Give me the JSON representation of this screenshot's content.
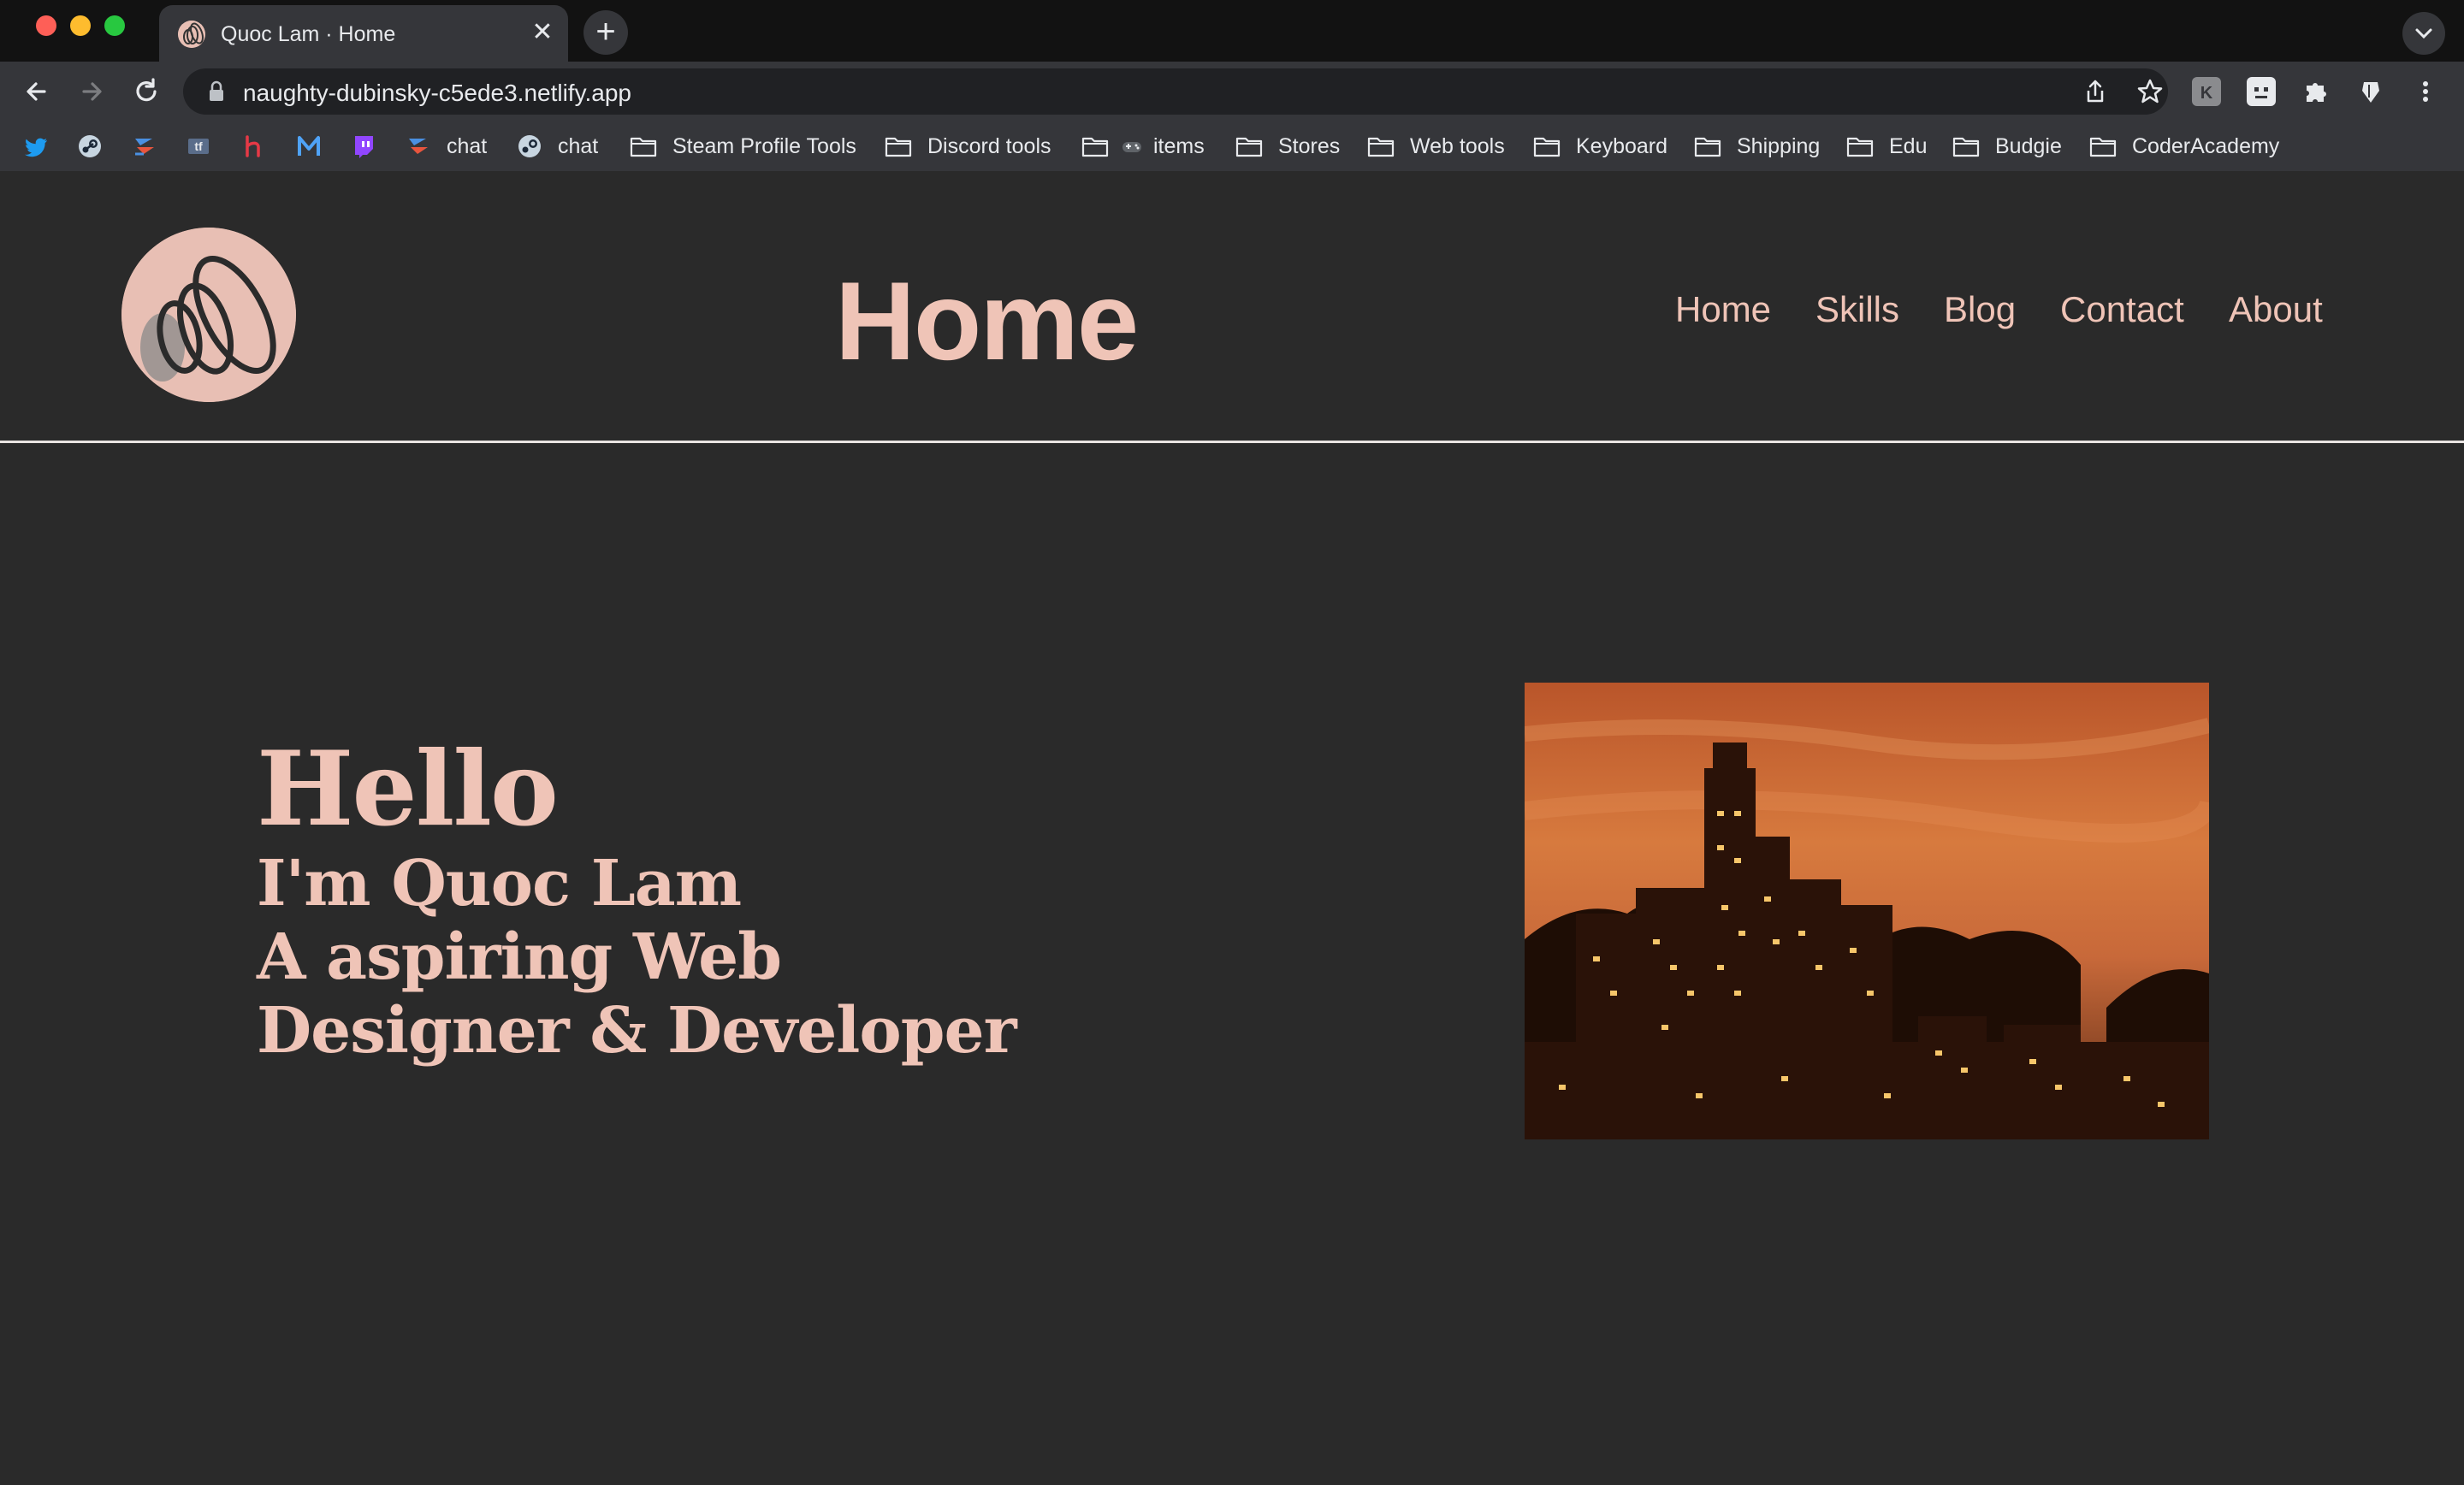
{
  "browser": {
    "tab_title": "Quoc Lam · Home",
    "tab_close": "✕",
    "new_tab": "+",
    "url": "naughty-dubinsky-c5ede3.netlify.app",
    "bookmarks": [
      {
        "icon": "twitter-icon",
        "label": ""
      },
      {
        "icon": "steam-icon",
        "label": ""
      },
      {
        "icon": "zendesk-icon",
        "label": ""
      },
      {
        "icon": "tf-icon",
        "label": ""
      },
      {
        "icon": "h-logo-icon",
        "label": ""
      },
      {
        "icon": "m-logo-icon",
        "label": ""
      },
      {
        "icon": "twitch-icon",
        "label": ""
      },
      {
        "icon": "chat-app-icon",
        "label": "chat"
      },
      {
        "icon": "steam-icon",
        "label": "chat"
      },
      {
        "icon": "folder-icon",
        "label": "Steam Profile Tools"
      },
      {
        "icon": "folder-icon",
        "label": "Discord tools"
      },
      {
        "icon": "folder-icon",
        "label": "items"
      },
      {
        "icon": "folder-icon",
        "label": "Stores"
      },
      {
        "icon": "folder-icon",
        "label": "Web tools"
      },
      {
        "icon": "folder-icon",
        "label": "Keyboard"
      },
      {
        "icon": "folder-icon",
        "label": "Shipping"
      },
      {
        "icon": "folder-icon",
        "label": "Edu"
      },
      {
        "icon": "folder-icon",
        "label": "Budgie"
      },
      {
        "icon": "folder-icon",
        "label": "CoderAcademy"
      }
    ]
  },
  "site": {
    "title": "Home",
    "nav": [
      "Home",
      "Skills",
      "Blog",
      "Contact",
      "About"
    ],
    "hero": {
      "greeting": "Hello",
      "lines": [
        "I'm Quoc Lam",
        "A aspiring Web",
        "Designer & Developer"
      ]
    },
    "accent_color": "#efc4b7",
    "background_color": "#2a2a2a"
  }
}
